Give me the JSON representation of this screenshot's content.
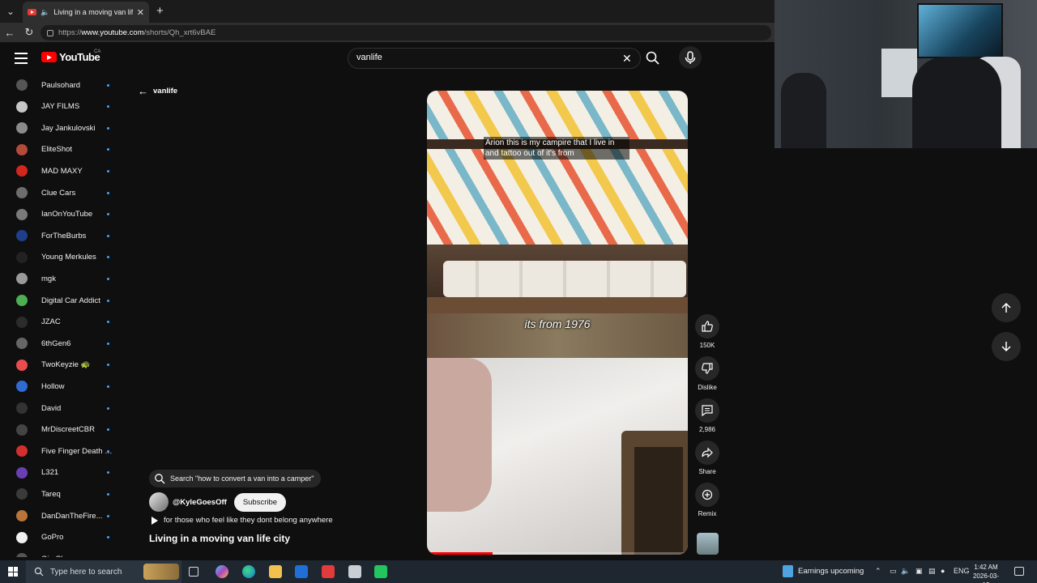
{
  "browser": {
    "tab_title": "Living in a moving van life city",
    "url_prefix": "https://",
    "url_host": "www.youtube.com",
    "url_path": "/shorts/Qh_xrt6vBAE"
  },
  "masthead": {
    "logo_text": "YouTube",
    "region": "CA",
    "search_value": "vanlife"
  },
  "sidebar": {
    "subscriptions": [
      {
        "name": "Paulsohard",
        "color": "#555555"
      },
      {
        "name": "JAY FILMS",
        "color": "#c7c7c7"
      },
      {
        "name": "Jay Jankulovski",
        "color": "#8a8a8a"
      },
      {
        "name": "EliteShot",
        "color": "#b34a3a"
      },
      {
        "name": "MAD MAXY",
        "color": "#d2261f"
      },
      {
        "name": "Clue Cars",
        "color": "#6d6d6d"
      },
      {
        "name": "IanOnYouTube",
        "color": "#7a7a7a"
      },
      {
        "name": "ForTheBurbs",
        "color": "#1f3f8a"
      },
      {
        "name": "Young Merkules",
        "color": "#222222"
      },
      {
        "name": "mgk",
        "color": "#9a9a9a"
      },
      {
        "name": "Digital Car Addict",
        "color": "#4caf50"
      },
      {
        "name": "JZAC",
        "color": "#2c2c2c"
      },
      {
        "name": "6thGen6",
        "color": "#666666"
      },
      {
        "name": "TwoKeyzie 🐢",
        "color": "#e84c4c"
      },
      {
        "name": "Hollow",
        "color": "#2f6bd1"
      },
      {
        "name": "David",
        "color": "#333333"
      },
      {
        "name": "MrDiscreetCBR",
        "color": "#444444"
      },
      {
        "name": "Five Finger Death P...",
        "color": "#d32f2f"
      },
      {
        "name": "L321",
        "color": "#6a3fb5"
      },
      {
        "name": "Tareq",
        "color": "#3a3a3a"
      },
      {
        "name": "DanDanTheFire...",
        "color": "#b8743a"
      },
      {
        "name": "GoPro",
        "color": "#f1f1f1"
      },
      {
        "name": "Gio Chopz",
        "color": "#555555"
      }
    ]
  },
  "back_label": "vanlife",
  "player": {
    "caption_top": "Arion this is my campire that I live in\nand tattoo out of it's from",
    "caption_mid": "its from 1976",
    "progress": 0.25
  },
  "actions": {
    "like_count": "150K",
    "dislike_label": "Dislike",
    "comment_count": "2,986",
    "share_label": "Share",
    "remix_label": "Remix"
  },
  "short_info": {
    "search_suggestion": "Search \"how to convert a van into a camper\"",
    "channel": "@KyleGoesOff",
    "subscribe_label": "Subscribe",
    "music_text": "for those who feel like they dont belong anywhere",
    "title": "Living in a moving van life city"
  },
  "taskbar": {
    "search_placeholder": "Type here to search",
    "widget_text": "Earnings upcoming",
    "language": "ENG",
    "time": "1:42 AM",
    "date": "2026-03-12"
  }
}
